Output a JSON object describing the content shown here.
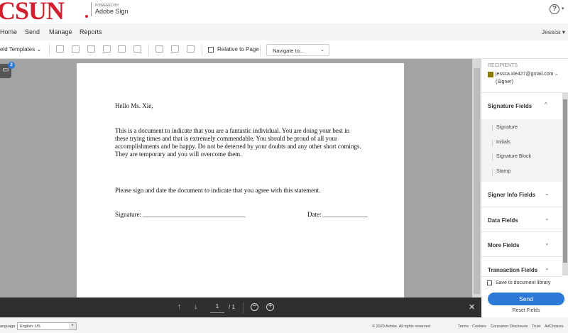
{
  "header": {
    "logo": "CSUN",
    "powered_by": "POWERED BY",
    "product": "Adobe Sign",
    "help": "?"
  },
  "nav": {
    "items": [
      "Home",
      "Send",
      "Manage",
      "Reports"
    ],
    "user": "Jessca ▾"
  },
  "toolbar": {
    "field_templates": "eld Templates",
    "relative_label": "Relative to Page",
    "navigate": "Navigate to..."
  },
  "document": {
    "greeting": "Hello Ms. Xie,",
    "para1": [
      "This is a document to indicate that you are a fantastic individual. You are doing your best in",
      "these trying times and that is extremely commendable. You should be proud of all your",
      "accomplishments and be happy. Do not be deterred by your doubts and any other short comings.",
      "They are temporary and you will overcome them."
    ],
    "para2": "Please sign and date the document to indicate that you agree with this statement.",
    "signature": "Signature: ________________________________",
    "date": "Date: ______________"
  },
  "comments_badge": "2",
  "pager": {
    "current": "1",
    "total": "/ 1"
  },
  "panel": {
    "recipients_label": "RECIPIENTS",
    "recipient_email": "jessca.xie427@gmail.com",
    "recipient_role": "(Signer)",
    "recipient_color": "#8a7a00",
    "signature_fields": {
      "title": "Signature Fields",
      "items": [
        "Signature",
        "Initials",
        "Signature Block",
        "Stamp"
      ]
    },
    "sections": [
      "Signer Info Fields",
      "Data Fields",
      "More Fields",
      "Transaction Fields"
    ],
    "save_label": "Save to document library",
    "send": "Send",
    "reset": "Reset Fields"
  },
  "footer": {
    "language_label": "anguage",
    "language": "English: US",
    "copyright": "© 2020 Adobe. All rights reserved.",
    "links": [
      "Terms",
      "Cookies",
      "Consumer Disclosure",
      "Trust",
      "AdChoices"
    ]
  },
  "colors": {
    "accent": "#2d7ad6",
    "brand": "#d2202f"
  }
}
